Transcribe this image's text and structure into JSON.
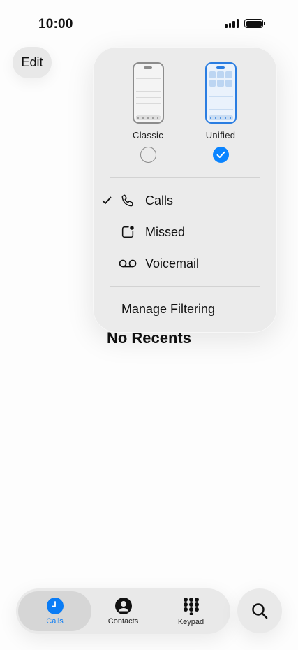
{
  "status_bar": {
    "time": "10:00",
    "icons": [
      "signal-icon",
      "battery-icon"
    ]
  },
  "header": {
    "edit_label": "Edit"
  },
  "popover": {
    "layouts": [
      {
        "label": "Classic",
        "selected": false,
        "icon": "classic-layout-icon"
      },
      {
        "label": "Unified",
        "selected": true,
        "icon": "unified-layout-icon"
      }
    ],
    "filters": [
      {
        "label": "Calls",
        "icon": "phone-icon",
        "selected": true
      },
      {
        "label": "Missed",
        "icon": "missed-call-icon",
        "selected": false
      },
      {
        "label": "Voicemail",
        "icon": "voicemail-icon",
        "selected": false
      }
    ],
    "manage_label": "Manage Filtering"
  },
  "main": {
    "empty_text": "No Recents"
  },
  "tabbar": {
    "tabs": [
      {
        "label": "Calls",
        "icon": "clock-icon",
        "active": true
      },
      {
        "label": "Contacts",
        "icon": "person-circle-icon",
        "active": false
      },
      {
        "label": "Keypad",
        "icon": "keypad-icon",
        "active": false
      }
    ],
    "search_icon": "search-icon"
  },
  "colors": {
    "accent": "#0a84ff",
    "background": "#fdfdfd",
    "popover": "#ebebeb"
  }
}
